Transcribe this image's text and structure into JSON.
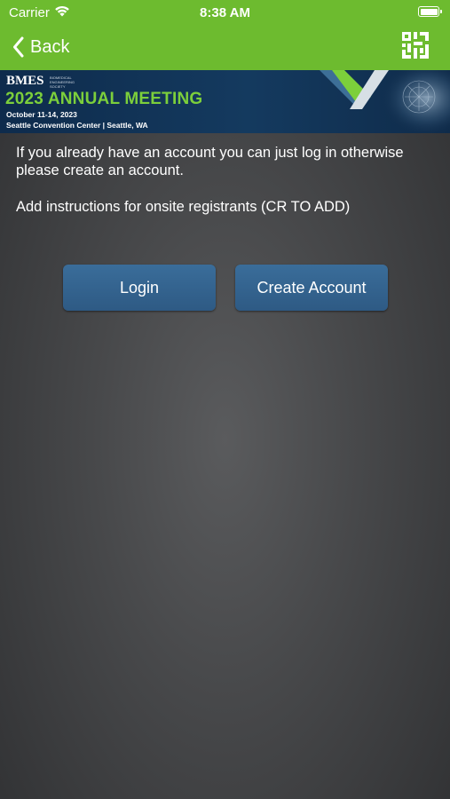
{
  "status_bar": {
    "carrier": "Carrier",
    "time": "8:38 AM"
  },
  "nav": {
    "back_label": "Back",
    "qr_icon": "qr-scan-icon"
  },
  "banner": {
    "org": "BMES",
    "org_subtitle": "BIOMEDICAL ENGINEERING SOCIETY",
    "title": "2023 ANNUAL MEETING",
    "dates": "October 11-14, 2023",
    "venue": "Seattle Convention Center | Seattle, WA"
  },
  "content": {
    "intro": "If you already have an account you can just log in otherwise please create an account.",
    "instructions": "Add instructions for onsite registrants (CR TO ADD)"
  },
  "buttons": {
    "login": "Login",
    "create_account": "Create Account"
  },
  "colors": {
    "header_green": "#6dbb2f",
    "button_blue": "#336390",
    "banner_navy": "#0e2b4c"
  }
}
